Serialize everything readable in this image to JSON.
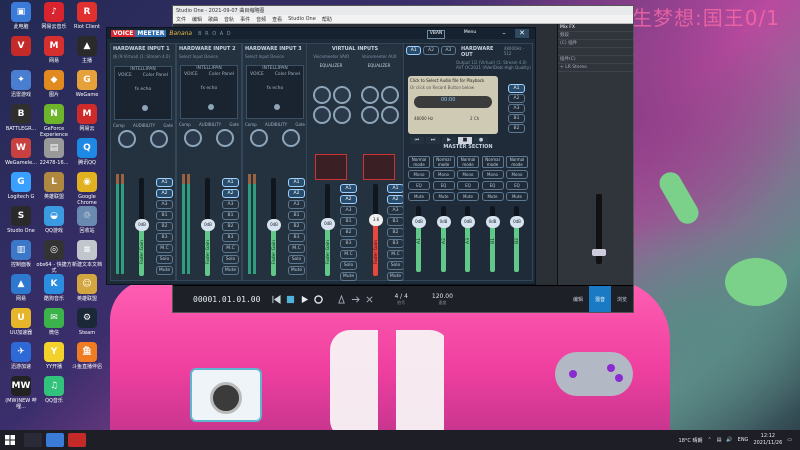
{
  "watermark": "今生梦想:国王0/1",
  "desktop": {
    "icons": [
      {
        "label": "此电脑",
        "color": "#3b7bd8",
        "glyph": "▣"
      },
      {
        "label": "网易云音乐",
        "color": "#d9232e",
        "glyph": "♪"
      },
      {
        "label": "Riot Client",
        "color": "#e0312f",
        "glyph": "R"
      },
      {
        "label": "",
        "color": "#c52a2a",
        "glyph": "V"
      },
      {
        "label": "网易",
        "color": "#d62f2f",
        "glyph": "M"
      },
      {
        "label": "主播",
        "color": "#2a2a2a",
        "glyph": "▲"
      },
      {
        "label": "迅雷游戏",
        "color": "#4a7ed0",
        "glyph": "✦"
      },
      {
        "label": "图片",
        "color": "#e08a1f",
        "glyph": "◆"
      },
      {
        "label": "WeGame",
        "color": "#e7a13a",
        "glyph": "G"
      },
      {
        "label": "BATTLEGR...",
        "color": "#2f2f2f",
        "glyph": "B"
      },
      {
        "label": "GeForce Experience",
        "color": "#6eb52c",
        "glyph": "N"
      },
      {
        "label": "网易云",
        "color": "#d02b2b",
        "glyph": "M"
      },
      {
        "label": "WeGamele...",
        "color": "#c84040",
        "glyph": "W"
      },
      {
        "label": "22478-16...",
        "color": "#999999",
        "glyph": "▤"
      },
      {
        "label": "腾讯QQ",
        "color": "#1e88e5",
        "glyph": "Q"
      },
      {
        "label": "Logitech G",
        "color": "#3aa0ff",
        "glyph": "G"
      },
      {
        "label": "英雄联盟",
        "color": "#b08840",
        "glyph": "L"
      },
      {
        "label": "Google Chrome",
        "color": "#e2b11f",
        "glyph": "◉"
      },
      {
        "label": "Studio One",
        "color": "#2a2a2a",
        "glyph": "S"
      },
      {
        "label": "QQ游戏",
        "color": "#3b9be0",
        "glyph": "◒"
      },
      {
        "label": "回收站",
        "color": "#6a8ab0",
        "glyph": "♲"
      },
      {
        "label": "控制面板",
        "color": "#3d78c8",
        "glyph": "▥"
      },
      {
        "label": "obs64 - 快捷方式",
        "color": "#333333",
        "glyph": "◎"
      },
      {
        "label": "新建文本文档",
        "color": "#c0c6cc",
        "glyph": "≡"
      },
      {
        "label": "网易",
        "color": "#2f78d0",
        "glyph": "▲"
      },
      {
        "label": "酷狗音乐",
        "color": "#2a8de0",
        "glyph": "K"
      },
      {
        "label": "英雄联盟",
        "color": "#d4a640",
        "glyph": "☺"
      },
      {
        "label": "UU加速器",
        "color": "#e5b52a",
        "glyph": "U"
      },
      {
        "label": "微信",
        "color": "#3cb34a",
        "glyph": "✉"
      },
      {
        "label": "Steam",
        "color": "#1b2838",
        "glyph": "⚙"
      },
      {
        "label": "迅游加速",
        "color": "#2e6ad6",
        "glyph": "✈"
      },
      {
        "label": "YY开播",
        "color": "#f2d12a",
        "glyph": "Y"
      },
      {
        "label": "斗鱼直播伴侣",
        "color": "#f07c22",
        "glyph": "鱼"
      },
      {
        "label": "(MW)NEW 哔哩...",
        "color": "#222222",
        "glyph": "MW"
      },
      {
        "label": "QQ音乐",
        "color": "#31c27c",
        "glyph": "♫"
      }
    ]
  },
  "studio_one": {
    "title": "Studio One - 2021-09-07   曲目缩略图",
    "menu": [
      "文件",
      "编辑",
      "歌曲",
      "音轨",
      "事件",
      "音频",
      "查看",
      "Studio One",
      "帮助"
    ],
    "time": "00001.01.01.00",
    "tempo": "120.00",
    "tempo_label": "速度",
    "signature": "4 / 4",
    "signature_label": "拍号",
    "tabs": [
      "编辑",
      "混音",
      "浏览"
    ],
    "right_panel_title": "Mix FX",
    "right_panel_rows": [
      "频段",
      "(C) 插件",
      "",
      "插件(C)",
      "+ LR Stereo"
    ]
  },
  "voicemeeter": {
    "logo_a": "VOICE",
    "logo_b": "MEETER",
    "logo_c": "Banana",
    "code": "B R O A D",
    "vban": "VBAN",
    "menu": "Menu",
    "strips": [
      {
        "title": "HARDWARE INPUT 1",
        "sub": "线 (9:Virtual) (1: Stream 4.0)",
        "intel": "INTELLIPAN",
        "voice": "VOICE",
        "color_panel": "Color Panel",
        "fx": "fx echo",
        "gain": "0dB",
        "fader_label": "Fader Gain"
      },
      {
        "title": "HARDWARE INPUT 2",
        "sub": "Select Input Device",
        "intel": "INTELLIPAN",
        "voice": "VOICE",
        "color_panel": "Color Panel",
        "fx": "fx echo",
        "gain": "0dB",
        "fader_label": "Fader Gain"
      },
      {
        "title": "HARDWARE INPUT 3",
        "sub": "Select Input Device",
        "intel": "INTELLIPAN",
        "voice": "VOICE",
        "color_panel": "Color Panel",
        "fx": "fx echo",
        "gain": "0dB",
        "fader_label": "Fader Gain"
      }
    ],
    "virtual": {
      "title": "VIRTUAL INPUTS",
      "sub1": "Voicemeeter VAIO",
      "sub2": "Voicemeeter AUX",
      "eq": "EQUALIZER",
      "gain1": "0dB",
      "gain2": "3.6",
      "fader_label": "Fader Gain"
    },
    "bus_labels": [
      "A1",
      "A2",
      "A3",
      "B1",
      "B2",
      "B3",
      "M.C",
      "Solo",
      "Mute"
    ],
    "small_knob_labels": [
      "Comp",
      "AUDIBILITY",
      "Gate"
    ],
    "hwout": {
      "title": "HARDWARE OUT",
      "rate": "48000Hz - 512",
      "dev1": "Output 1/2 (Virtual) (1: Stream 4.0)",
      "dev2": "AVT OC2021 (AVerlDebi High Quality)",
      "a_buttons": [
        "A1",
        "A2",
        "A3"
      ],
      "cassette_prompt": "Click to Select Audio file for Playback",
      "cassette_sub": "Or click on Record Button below",
      "cassette_time": "00:00",
      "cassette_rate": "48000 Hz",
      "cassette_ch": "2 Ch",
      "side_buttons": [
        "A1",
        "A2",
        "A3",
        "B1",
        "B2"
      ],
      "master_title": "MASTER SECTION",
      "master_modes": [
        "Normal mode",
        "Normal mode",
        "Normal mode",
        "Normal mode",
        "Normal mode"
      ],
      "master_btns": [
        "Mono",
        "EQ",
        "Mute"
      ],
      "master_gain": "0dB",
      "master_labels": [
        "A1",
        "A2",
        "A3",
        "B1",
        "B2"
      ]
    }
  },
  "taskbar": {
    "weather": "18°C 晴朗",
    "lang": "ENG",
    "time": "12:12",
    "date": "2021/11/26"
  }
}
